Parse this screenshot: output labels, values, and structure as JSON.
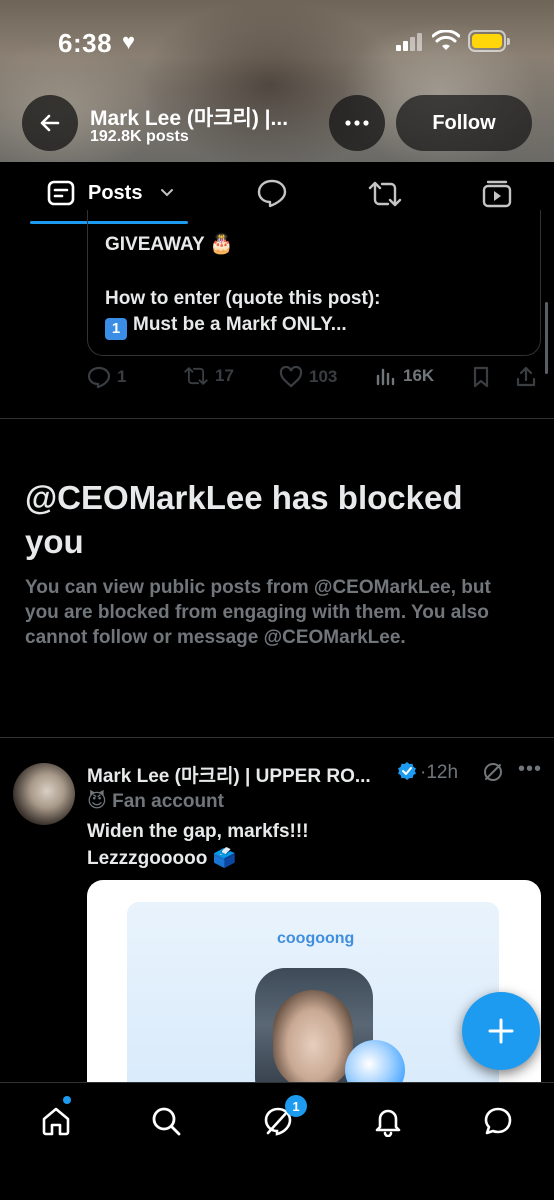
{
  "status_bar": {
    "time": "6:38",
    "heart": "♥",
    "battery_color": "#ffd60a"
  },
  "header": {
    "profile_name": "Mark Lee (마크리) |...",
    "posts_count": "192.8K posts",
    "follow_label": "Follow",
    "back_icon": "back-arrow-icon",
    "more_icon": "more-horizontal-icon"
  },
  "tabs": {
    "posts_label": "Posts"
  },
  "giveaway_tweet": {
    "line1": "GIVEAWAY 🎂",
    "line2": "How to enter (quote this post):",
    "line3_key": "1",
    "line3": "Must be a Markf ONLY...",
    "replies": "1",
    "reposts": "17",
    "likes": "103",
    "views": "16K"
  },
  "blocked": {
    "title": "@CEOMarkLee has blocked you",
    "body": "You can view public posts from @CEOMarkLee, but you are blocked from engaging with them. You also cannot follow or message @CEOMarkLee."
  },
  "tweet2": {
    "name": "Mark Lee (마크리) | UPPER RO...",
    "time": "·12h",
    "fan_label": "😈 Fan account",
    "text_line1": "Widen the gap, markfs!!!",
    "text_line2": "Lezzzgooooo 🗳️",
    "media_brand": "coogoong"
  },
  "bottom_nav": {
    "messages_badge": "1"
  },
  "colors": {
    "accent": "#1d9bf0",
    "muted": "#71767b",
    "text": "#e7e9ea"
  }
}
